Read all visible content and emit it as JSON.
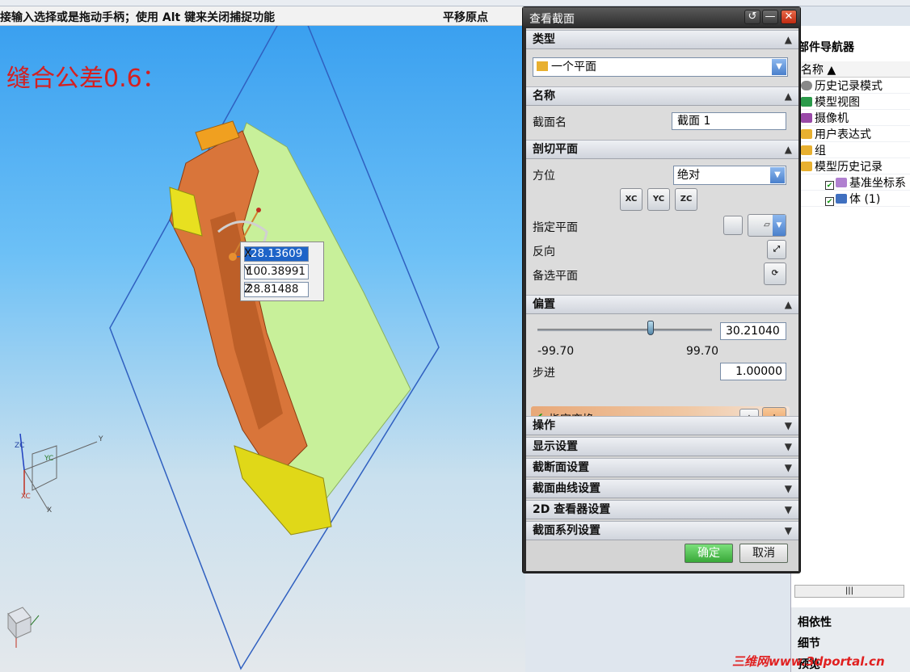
{
  "status_bar": {
    "message": "接输入选择或是拖动手柄；使用 Alt 键来关闭捕捉功能",
    "right_label": "平移原点"
  },
  "viewport": {
    "tolerance_text": "缝合公差0.6：",
    "coords": {
      "x_label": "X",
      "x_value": "-28.13609",
      "y_label": "Y",
      "y_value": "100.38991",
      "z_label": "Z",
      "z_value": "28.81488"
    },
    "axis_labels": {
      "y": "Y",
      "z": "Z",
      "zc": "ZC",
      "yc": "YC",
      "xc": "XC",
      "x": "X"
    }
  },
  "dialog": {
    "title": "查看截面",
    "titlebar_buttons": [
      "↺",
      "—",
      "✕"
    ],
    "sections": {
      "type": {
        "header": "类型",
        "selected": "一个平面"
      },
      "name": {
        "header": "名称",
        "label": "截面名",
        "value": "截面 1"
      },
      "cut_plane": {
        "header": "剖切平面",
        "orientation_label": "方位",
        "orientation_value": "绝对",
        "plane_buttons": [
          "XC",
          "YC",
          "ZC"
        ],
        "specify_plane_label": "指定平面",
        "reverse_label": "反向",
        "alt_plane_label": "备选平面"
      },
      "offset": {
        "header": "偏置",
        "slider_value": "30.21040",
        "slider_fraction": 0.65,
        "min_label": "-99.70",
        "max_label": "99.70",
        "step_label": "步进",
        "step_value": "1.00000",
        "transform_label": "指定变换"
      },
      "collapsed": [
        "操作",
        "显示设置",
        "截断面设置",
        "截面曲线设置",
        "2D 查看器设置",
        "截面系列设置"
      ]
    },
    "buttons": {
      "ok": "确定",
      "cancel": "取消"
    }
  },
  "navigator": {
    "title": "部件导航器",
    "column_header": "名称",
    "items": [
      "历史记录模式",
      "模型视图",
      "摄像机",
      "用户表达式",
      "组",
      "模型历史记录",
      "基准坐标系",
      "体 (1)"
    ],
    "lower_sections": [
      "相依性",
      "细节",
      "预览"
    ]
  },
  "watermark": "三维网www.3dportal.cn",
  "colors": {
    "tolerance": "#d42020",
    "accent_blue": "#1e64c8",
    "ok_green": "#38a838",
    "plane_blue": "#3060c0"
  }
}
